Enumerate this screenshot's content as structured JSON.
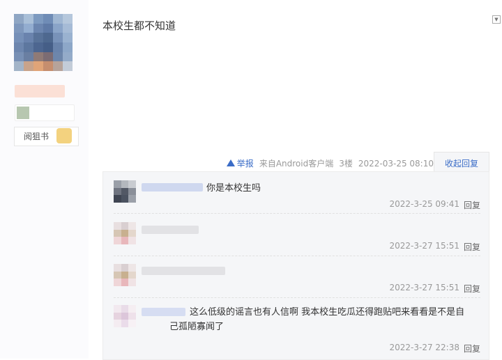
{
  "author": {
    "badge_text": "阅狙书",
    "avatar_icon": "avatar-icon"
  },
  "post": {
    "content": "本校生都不知道",
    "report_label": "举报",
    "source": "来自Android客户端",
    "floor": "3楼",
    "datetime": "2022-03-25 08:10",
    "collapse_label": "收起回复"
  },
  "replies": [
    {
      "content": "你是本校生吗",
      "time": "2022-3-25 09:41",
      "reply_label": "回复"
    },
    {
      "content": "",
      "time": "2022-3-27 15:51",
      "reply_label": "回复"
    },
    {
      "content": "",
      "time": "2022-3-27 15:51",
      "reply_label": "回复"
    },
    {
      "content_line1": "这么低级的谣言也有人信啊 我本校生吃瓜还得跑贴吧来看看是不是自",
      "content_line2": "己孤陋寡闻了",
      "time": "2022-3-27 22:38",
      "reply_label": "回复"
    }
  ],
  "colors": {
    "link": "#3a6cc7",
    "meta": "#999999",
    "reply_bg": "#f5f6f8"
  }
}
